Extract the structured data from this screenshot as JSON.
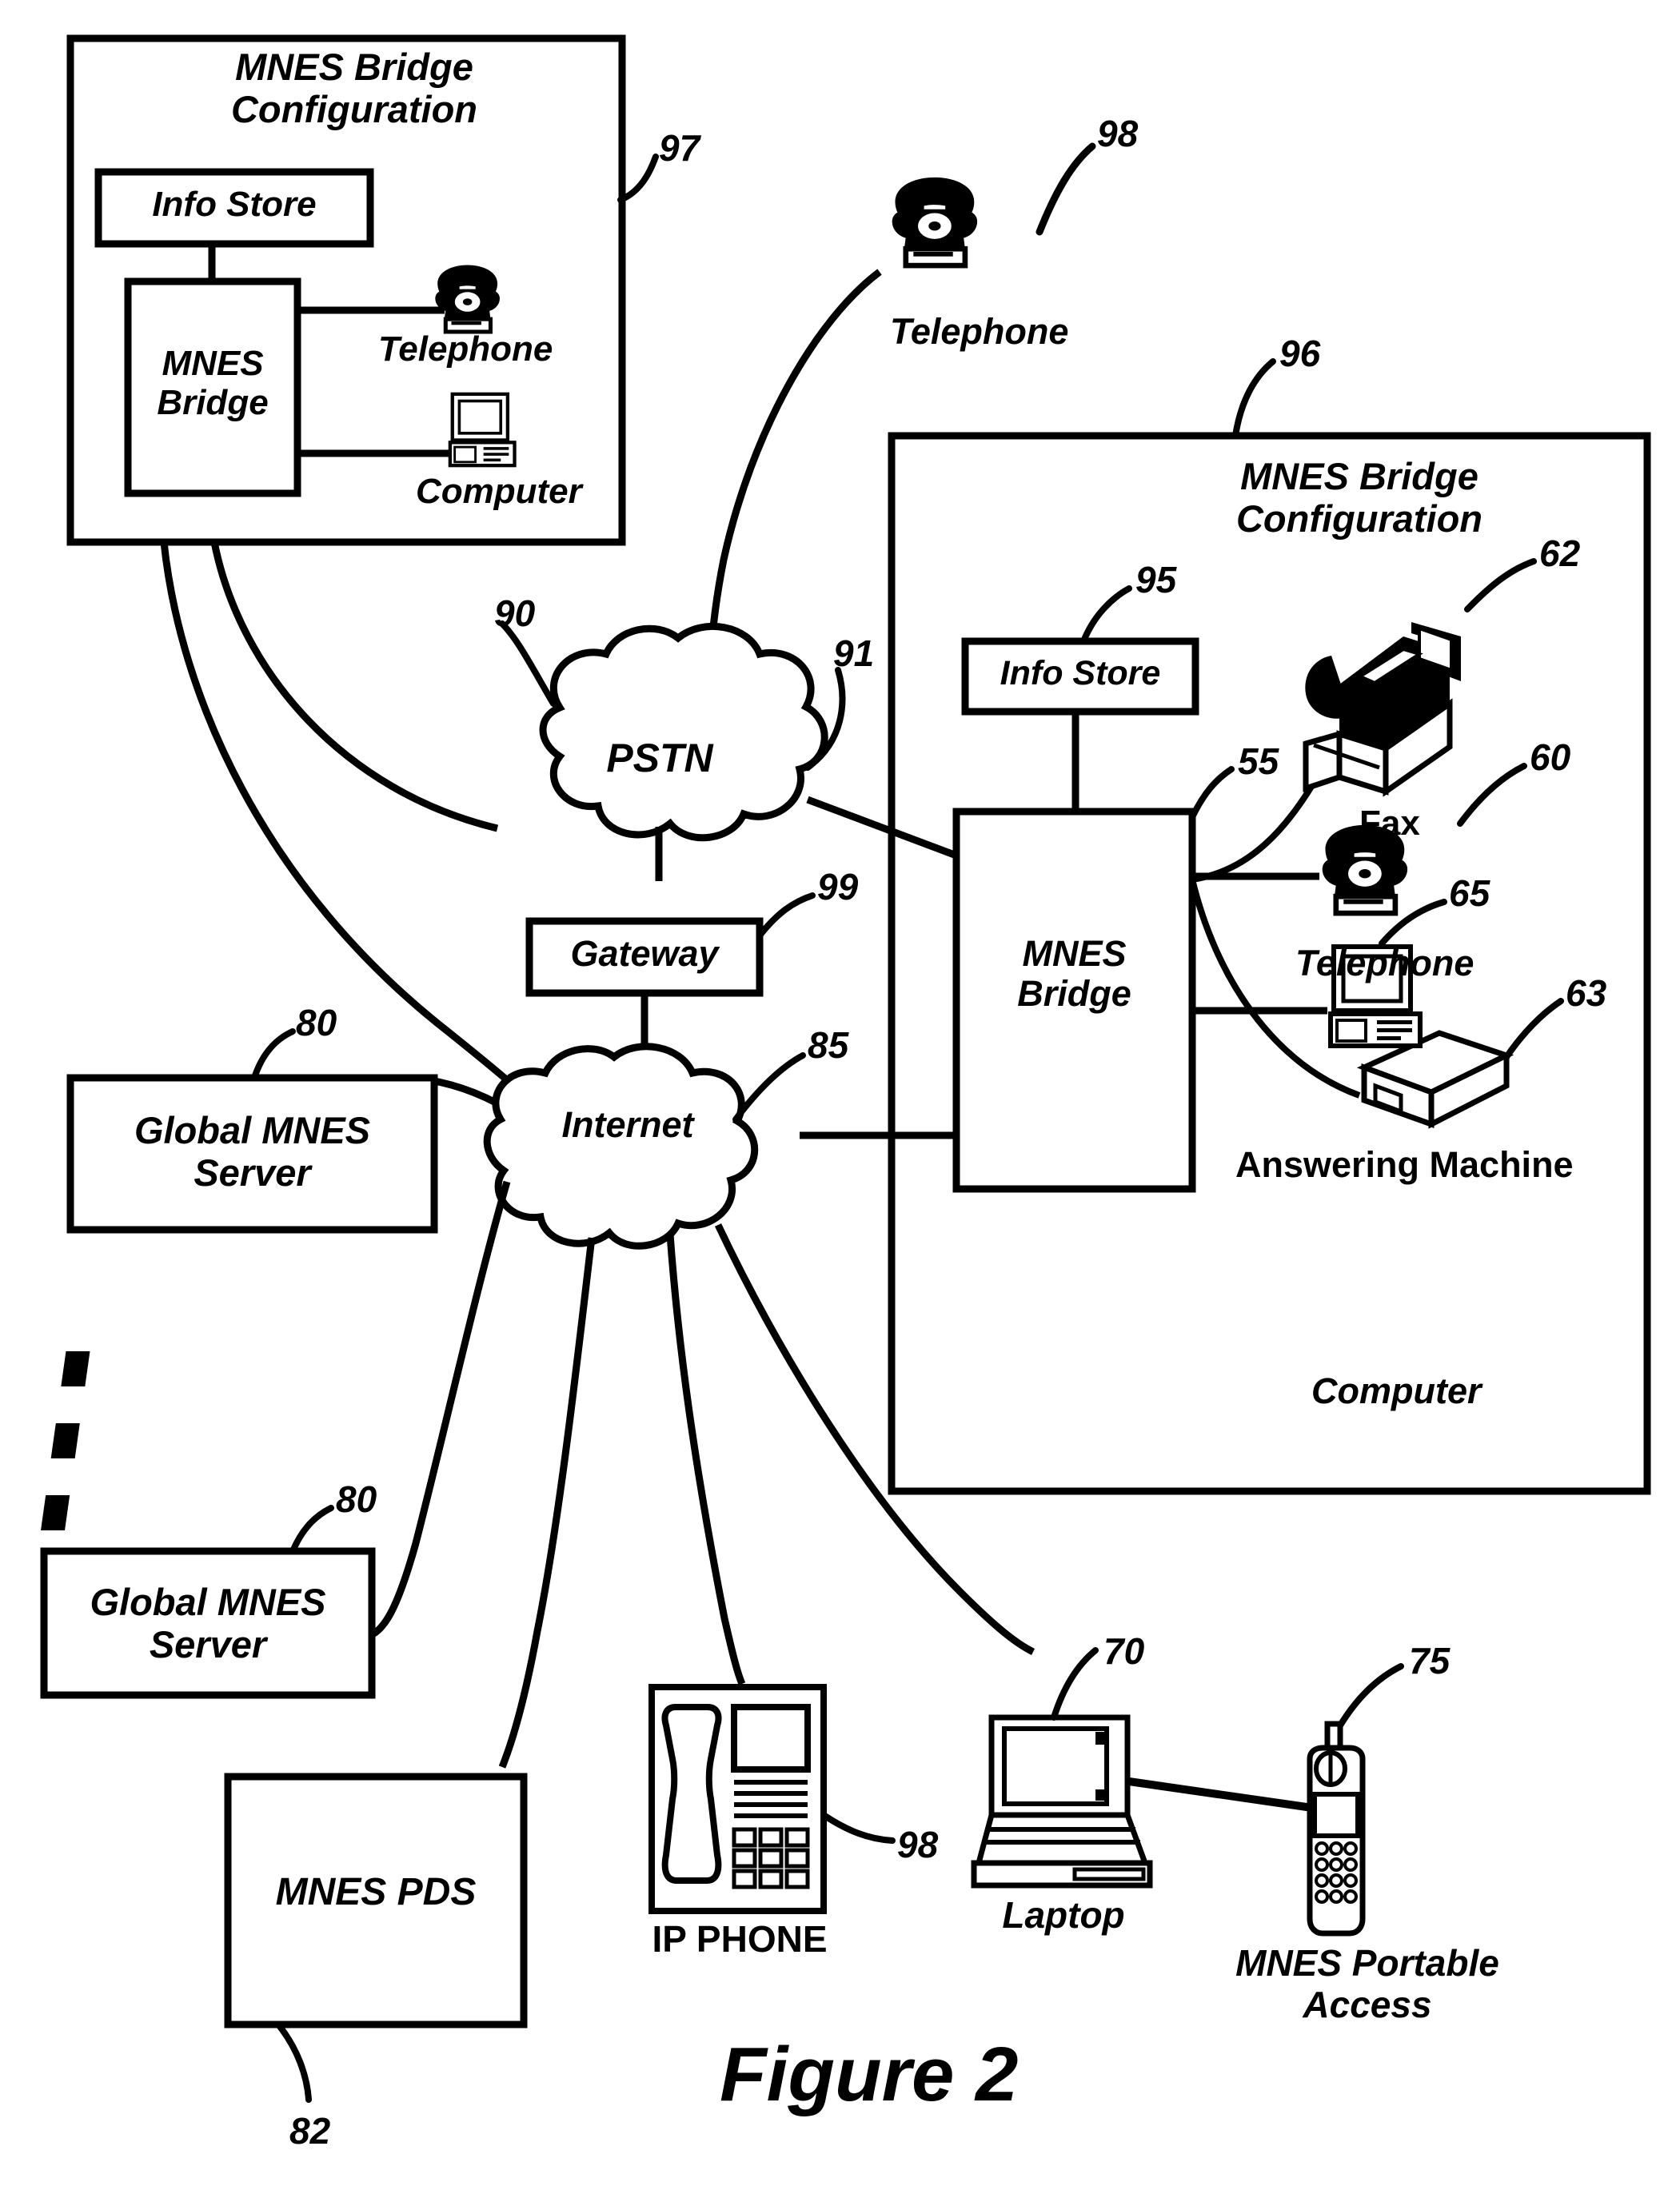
{
  "figure": {
    "caption": "Figure 2"
  },
  "boxes": {
    "left_config": {
      "title_line1": "MNES Bridge",
      "title_line2": "Configuration",
      "ref": "97",
      "info_store": "Info Store",
      "bridge_line1": "MNES",
      "bridge_line2": "Bridge",
      "telephone": "Telephone",
      "computer": "Computer"
    },
    "right_config": {
      "title_line1": "MNES Bridge",
      "title_line2": "Configuration",
      "ref": "96",
      "info_store": "Info Store",
      "info_store_ref": "95",
      "bridge_line1": "MNES",
      "bridge_line2": "Bridge",
      "bridge_ref": "55",
      "fax": "Fax",
      "fax_ref": "62",
      "telephone": "Telephone",
      "telephone_ref": "60",
      "answering_machine": "Answering Machine",
      "answering_machine_ref": "63",
      "computer": "Computer",
      "computer_ref": "65"
    }
  },
  "clouds": {
    "pstn": {
      "label": "PSTN",
      "ref": "90",
      "ref2": "91"
    },
    "internet": {
      "label": "Internet",
      "ref": "85"
    }
  },
  "nodes": {
    "gateway": {
      "label": "Gateway",
      "ref": "99"
    },
    "telephone_top": {
      "label": "Telephone",
      "ref": "98"
    },
    "global_server_1": {
      "line1": "Global MNES",
      "line2": "Server",
      "ref": "80"
    },
    "global_server_2": {
      "line1": "Global MNES",
      "line2": "Server",
      "ref": "80"
    },
    "mnes_pds": {
      "label": "MNES PDS",
      "ref": "82"
    },
    "ip_phone": {
      "label": "IP PHONE",
      "ref": "98"
    },
    "laptop": {
      "label": "Laptop",
      "ref": "70"
    },
    "portable_access": {
      "line1": "MNES Portable",
      "line2": "Access",
      "ref": "75"
    }
  },
  "colors": {
    "ink": "#000000",
    "paper": "#ffffff"
  }
}
